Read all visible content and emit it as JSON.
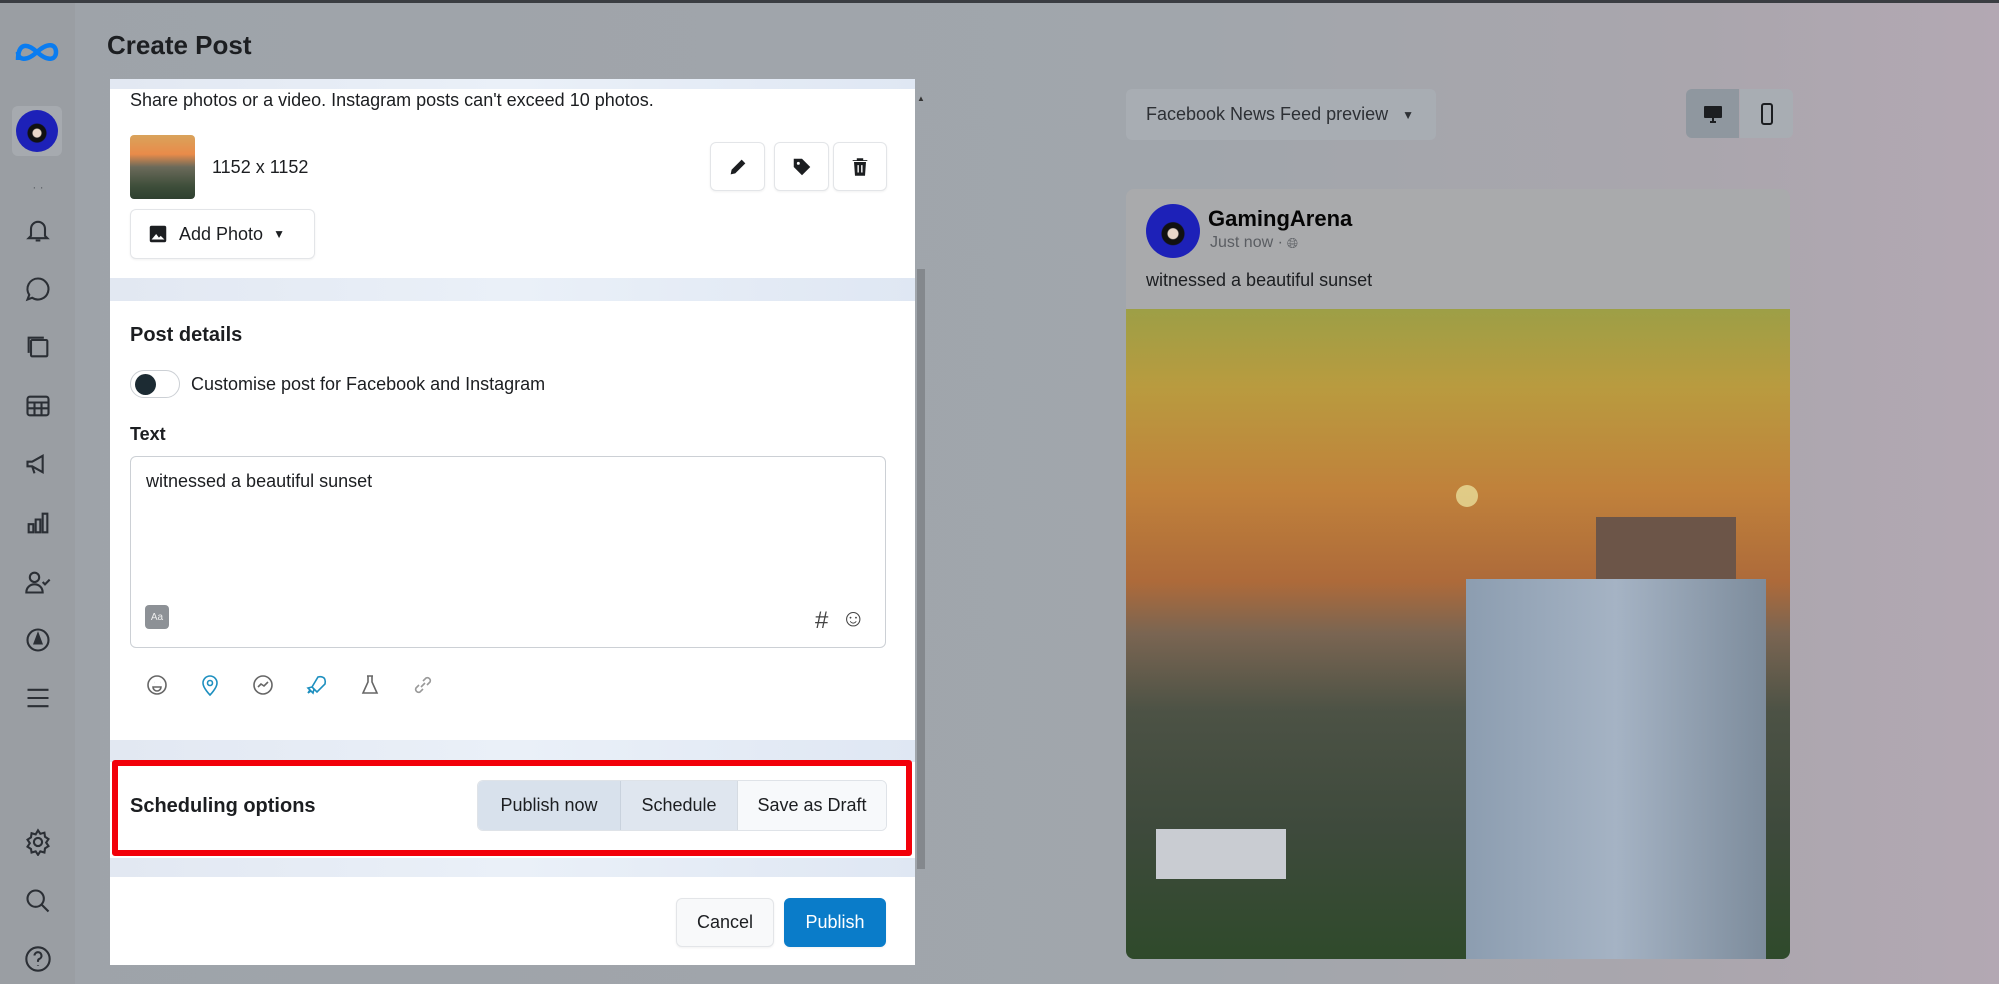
{
  "page_title": "Create Post",
  "sidebar": {
    "logo": "meta-logo-icon",
    "items": [
      "bell-icon",
      "chat-icon",
      "pages-icon",
      "table-icon",
      "megaphone-icon",
      "bar-chart-icon",
      "people-icon",
      "compass-icon",
      "menu-icon",
      "gear-icon",
      "search-icon",
      "help-icon"
    ]
  },
  "media": {
    "hint": "Share photos or a video. Instagram posts can't exceed 10 photos.",
    "dimensions": "1152 x 1152",
    "add_photo_label": "Add Photo"
  },
  "post_details": {
    "heading": "Post details",
    "customise_label": "Customise post for Facebook and Instagram",
    "customise_on": false,
    "text_label": "Text",
    "text_value": "witnessed a beautiful sunset"
  },
  "scheduling": {
    "heading": "Scheduling options",
    "options": [
      "Publish now",
      "Schedule",
      "Save as Draft"
    ],
    "selected": "Publish now"
  },
  "footer": {
    "cancel": "Cancel",
    "publish": "Publish"
  },
  "preview": {
    "dropdown": "Facebook News Feed preview",
    "page_name": "GamingArena",
    "time": "Just now ·",
    "text": "witnessed a beautiful sunset"
  },
  "colors": {
    "accent": "#0a7cc9",
    "highlight": "#f2000a",
    "selected_segment": "#d8e1ec"
  }
}
